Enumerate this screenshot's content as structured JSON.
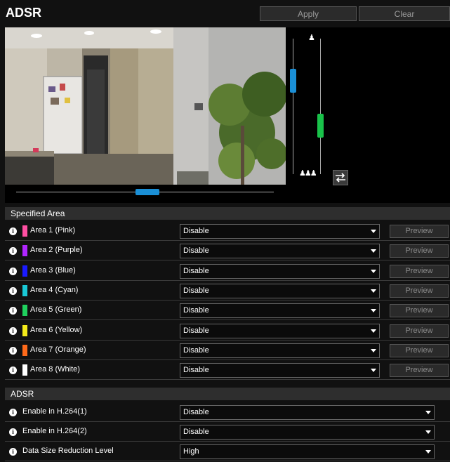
{
  "header": {
    "title": "ADSR",
    "apply_label": "Apply",
    "clear_label": "Clear"
  },
  "camera": {
    "horizontal_slider": {
      "value": 0.51
    },
    "vertical_slider_1": {
      "value": 0.27
    },
    "vertical_slider_2": {
      "value": 0.67
    },
    "colors": {
      "slider_blue": "#1a8fd6",
      "slider_green": "#19c24a"
    }
  },
  "specified_area": {
    "header": "Specified Area",
    "preview_label": "Preview",
    "rows": [
      {
        "label": "Area 1 (Pink)",
        "color": "#ff4fa2",
        "value": "Disable"
      },
      {
        "label": "Area 2 (Purple)",
        "color": "#b026ff",
        "value": "Disable"
      },
      {
        "label": "Area 3 (Blue)",
        "color": "#1a1aff",
        "value": "Disable"
      },
      {
        "label": "Area 4 (Cyan)",
        "color": "#19c9d6",
        "value": "Disable"
      },
      {
        "label": "Area 5 (Green)",
        "color": "#1fd15e",
        "value": "Disable"
      },
      {
        "label": "Area 6 (Yellow)",
        "color": "#f4ea1a",
        "value": "Disable"
      },
      {
        "label": "Area 7 (Orange)",
        "color": "#ff6a1a",
        "value": "Disable"
      },
      {
        "label": "Area 8 (White)",
        "color": "#ffffff",
        "value": "Disable"
      }
    ]
  },
  "adsr": {
    "header": "ADSR",
    "rows": [
      {
        "label": "Enable in H.264(1)",
        "value": "Disable"
      },
      {
        "label": "Enable in H.264(2)",
        "value": "Disable"
      },
      {
        "label": "Data Size Reduction Level",
        "value": "High"
      }
    ]
  }
}
